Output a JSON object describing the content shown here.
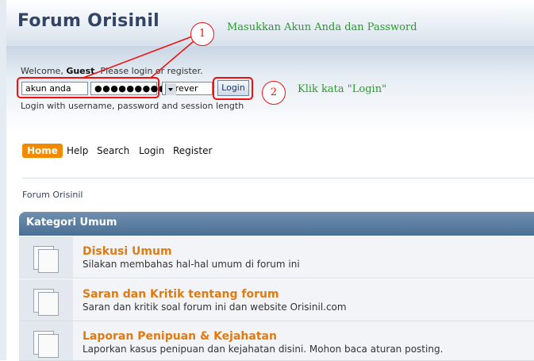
{
  "header": {
    "title": "Forum Orisinil"
  },
  "login": {
    "welcome_prefix": "Welcome, ",
    "guest": "Guest",
    "welcome_suffix": ". Please login or register.",
    "username_value": "akun anda",
    "password_value": "●●●●●●●●●●",
    "session_length": "Forever",
    "login_button": "Login",
    "hint": "Login with username, password and session length"
  },
  "annotations": {
    "step1_number": "1",
    "step1_note": "Masukkan Akun Anda dan Password",
    "step2_number": "2",
    "step2_note": "Klik kata \"Login\"",
    "color": "#ee1111",
    "note_color": "#2a9a2a"
  },
  "nav": {
    "home": "Home",
    "help": "Help",
    "search": "Search",
    "login": "Login",
    "register": "Register"
  },
  "breadcrumb": "Forum Orisinil",
  "category": {
    "name": "Kategori Umum",
    "forums": [
      {
        "title": "Diskusi Umum",
        "description": "Silakan membahas hal-hal umum di forum ini"
      },
      {
        "title": "Saran dan Kritik tentang forum",
        "description": "Saran dan kritik soal forum ini dan website Orisinil.com"
      },
      {
        "title": "Laporan Penipuan & Kejahatan",
        "description": "Laporkan kasus penipuan dan kejahatan disini. Mohon baca aturan posting."
      }
    ]
  },
  "icons": [
    "forum-board-icon",
    "dropdown-arrow-icon"
  ],
  "colors": {
    "accent": "#f28a00",
    "title": "#334466",
    "forum_link": "#e07b12",
    "category_bar": "#5a7ea3"
  }
}
